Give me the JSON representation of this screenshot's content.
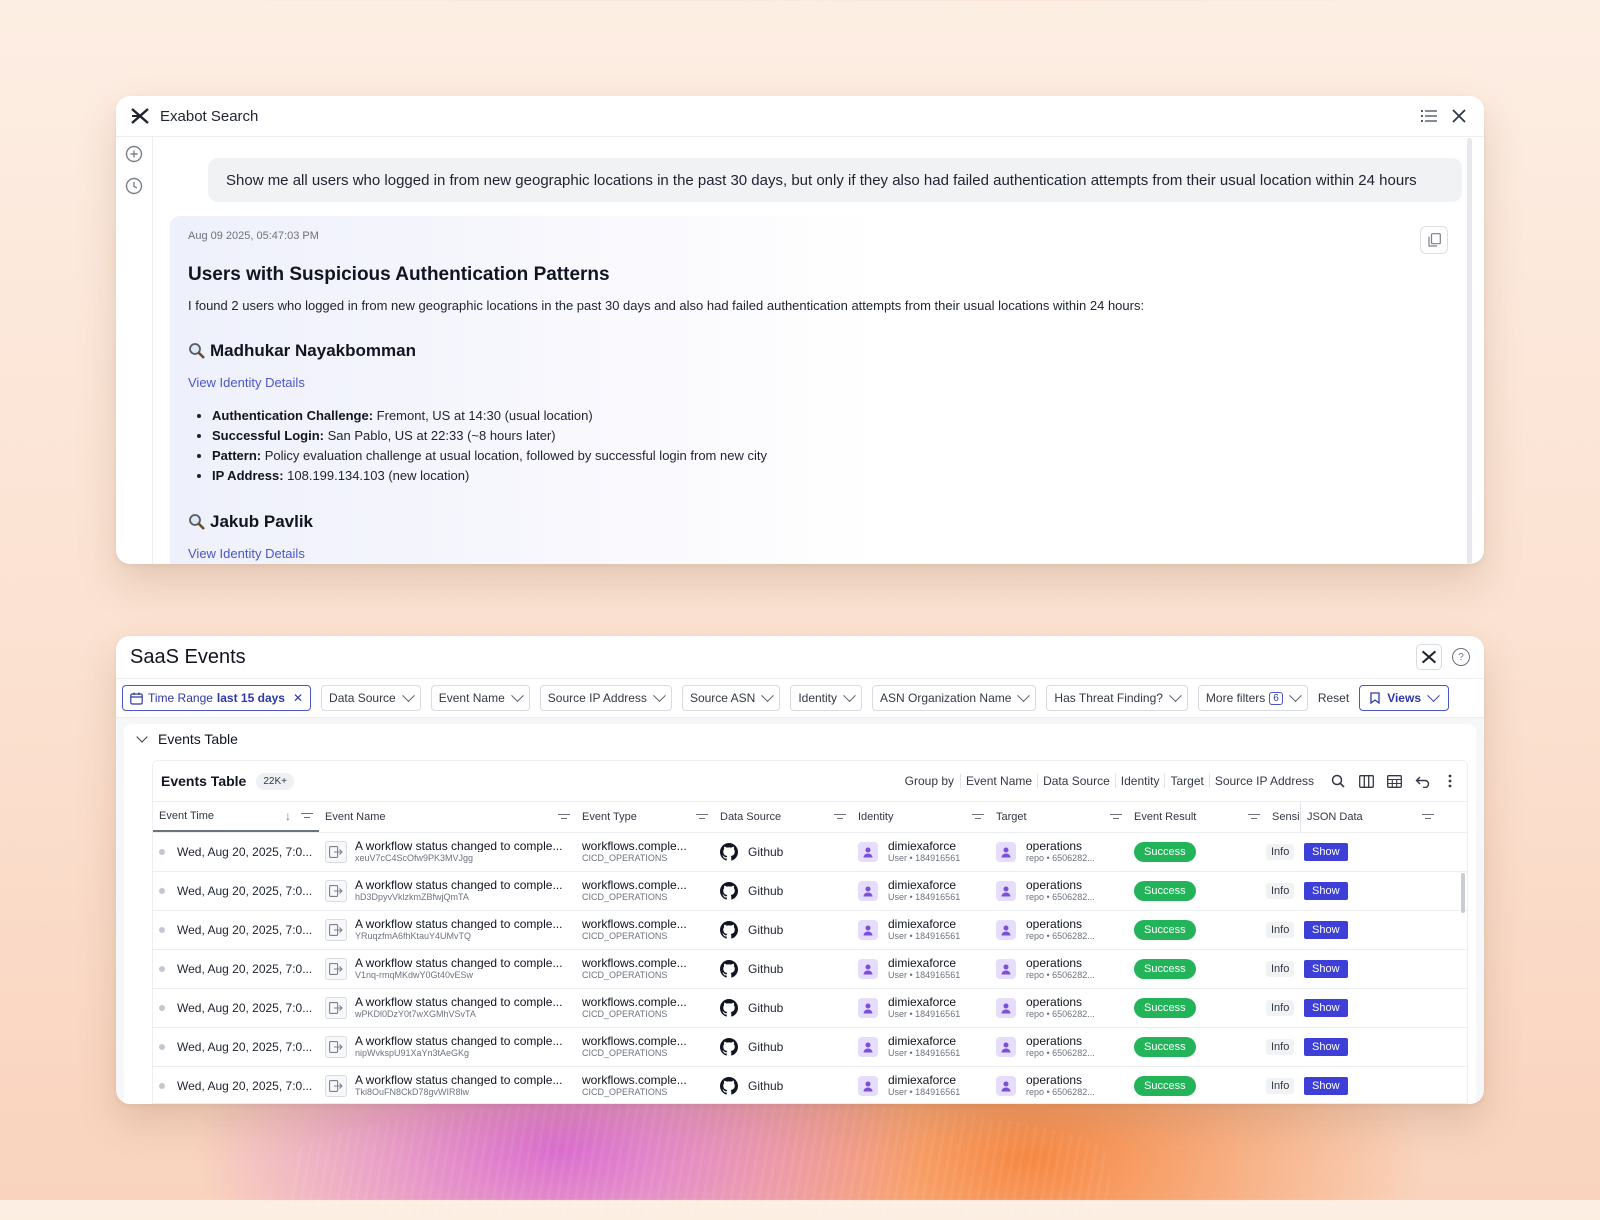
{
  "exabot": {
    "title": "Exabot Search",
    "user_query": "Show me all users who logged in from new geographic locations in the past 30 days, but only if they also had failed authentication attempts from their usual location within 24 hours",
    "response": {
      "timestamp": "Aug 09 2025, 05:47:03 PM",
      "heading": "Users with Suspicious Authentication Patterns",
      "intro": "I found 2 users who logged in from new geographic locations in the past 30 days and also had failed authentication attempts from their usual locations within 24 hours:",
      "users": [
        {
          "name": "Madhukar Nayakbomman",
          "link": "View Identity Details",
          "bullets": [
            {
              "label": "Authentication Challenge:",
              "text": " Fremont, US at 14:30 (usual location)"
            },
            {
              "label": "Successful Login:",
              "text": " San Pablo, US at 22:33 (~8 hours later)"
            },
            {
              "label": "Pattern:",
              "text": " Policy evaluation challenge at usual location, followed by successful login from new city"
            },
            {
              "label": "IP Address:",
              "text": " 108.199.134.103 (new location)"
            }
          ]
        },
        {
          "name": "Jakub Pavlik",
          "link": "View Identity Details"
        }
      ]
    }
  },
  "saas": {
    "title": "SaaS Events",
    "filters": {
      "time_range_label": "Time Range",
      "time_range_value": "last 15 days",
      "items": [
        "Data Source",
        "Event Name",
        "Source IP Address",
        "Source ASN",
        "Identity",
        "ASN Organization Name",
        "Has Threat Finding?"
      ],
      "more_filters": "More filters",
      "more_filters_count": "6",
      "reset": "Reset",
      "views": "Views"
    },
    "section_title": "Events Table",
    "table": {
      "title": "Events Table",
      "count": "22K+",
      "group_by_label": "Group by",
      "group_by": [
        "Event Name",
        "Data Source",
        "Identity",
        "Target",
        "Source IP Address"
      ],
      "columns": [
        "Event Time",
        "Event Name",
        "Event Type",
        "Data Source",
        "Identity",
        "Target",
        "Event Result",
        "Sensi",
        "JSON Data"
      ],
      "rows": [
        {
          "time": "Wed, Aug 20, 2025, 7:0...",
          "name": "A workflow status changed to comple...",
          "id": "xeuV7cC4ScOfw9PK3MVJgg",
          "type": "workflows.comple...",
          "type_sub": "CICD_OPERATIONS",
          "source": "Github",
          "identity": "dimiexaforce",
          "identity_sub": "User • 184916561",
          "target": "operations",
          "target_sub": "repo • 6506282...",
          "result": "Success",
          "sens": "Info",
          "json": "Show"
        },
        {
          "time": "Wed, Aug 20, 2025, 7:0...",
          "name": "A workflow status changed to comple...",
          "id": "hD3DpyvVklzkmZBfwjQmTA",
          "type": "workflows.comple...",
          "type_sub": "CICD_OPERATIONS",
          "source": "Github",
          "identity": "dimiexaforce",
          "identity_sub": "User • 184916561",
          "target": "operations",
          "target_sub": "repo • 6506282...",
          "result": "Success",
          "sens": "Info",
          "json": "Show"
        },
        {
          "time": "Wed, Aug 20, 2025, 7:0...",
          "name": "A workflow status changed to comple...",
          "id": "YRuqzfmA6fhKtauY4UMvTQ",
          "type": "workflows.comple...",
          "type_sub": "CICD_OPERATIONS",
          "source": "Github",
          "identity": "dimiexaforce",
          "identity_sub": "User • 184916561",
          "target": "operations",
          "target_sub": "repo • 6506282...",
          "result": "Success",
          "sens": "Info",
          "json": "Show"
        },
        {
          "time": "Wed, Aug 20, 2025, 7:0...",
          "name": "A workflow status changed to comple...",
          "id": "V1nq-rmqMKdwY0Gt40vESw",
          "type": "workflows.comple...",
          "type_sub": "CICD_OPERATIONS",
          "source": "Github",
          "identity": "dimiexaforce",
          "identity_sub": "User • 184916561",
          "target": "operations",
          "target_sub": "repo • 6506282...",
          "result": "Success",
          "sens": "Info",
          "json": "Show"
        },
        {
          "time": "Wed, Aug 20, 2025, 7:0...",
          "name": "A workflow status changed to comple...",
          "id": "wPKDl0DzY0t7wXGMhVSvTA",
          "type": "workflows.comple...",
          "type_sub": "CICD_OPERATIONS",
          "source": "Github",
          "identity": "dimiexaforce",
          "identity_sub": "User • 184916561",
          "target": "operations",
          "target_sub": "repo • 6506282...",
          "result": "Success",
          "sens": "Info",
          "json": "Show"
        },
        {
          "time": "Wed, Aug 20, 2025, 7:0...",
          "name": "A workflow status changed to comple...",
          "id": "nipWvkspU91XaYn3tAeGKg",
          "type": "workflows.comple...",
          "type_sub": "CICD_OPERATIONS",
          "source": "Github",
          "identity": "dimiexaforce",
          "identity_sub": "User • 184916561",
          "target": "operations",
          "target_sub": "repo • 6506282...",
          "result": "Success",
          "sens": "Info",
          "json": "Show"
        },
        {
          "time": "Wed, Aug 20, 2025, 7:0...",
          "name": "A workflow status changed to comple...",
          "id": "Tki8OuFN8CkD78gvWIR8lw",
          "type": "workflows.comple...",
          "type_sub": "CICD_OPERATIONS",
          "source": "Github",
          "identity": "dimiexaforce",
          "identity_sub": "User • 184916561",
          "target": "operations",
          "target_sub": "repo • 6506282...",
          "result": "Success",
          "sens": "Info",
          "json": "Show"
        }
      ]
    }
  },
  "colors": {
    "accent": "#4c56c9",
    "success": "#23b45a",
    "show_button": "#3d3fd6"
  }
}
